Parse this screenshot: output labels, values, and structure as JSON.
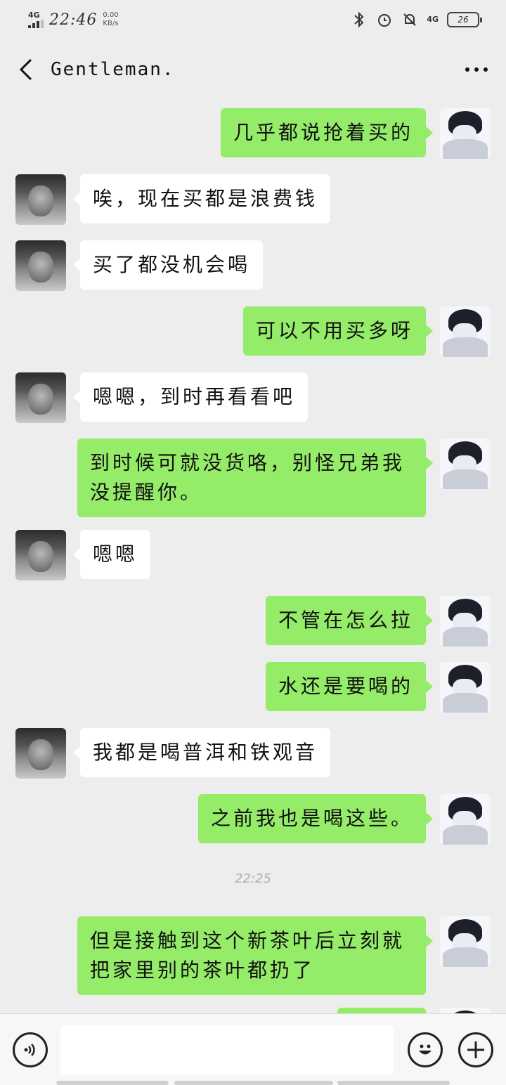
{
  "status_bar": {
    "network": "4G",
    "time": "22:46",
    "speed_value": "0.00",
    "speed_unit": "KB/s",
    "network_right": "4G",
    "battery": "26"
  },
  "header": {
    "title": "Gentleman.",
    "back_icon": "chevron-left-icon",
    "more_icon": "more-dots-icon"
  },
  "messages": [
    {
      "side": "out",
      "text": "几乎都说抢着买的"
    },
    {
      "side": "in",
      "text": "唉，现在买都是浪费钱"
    },
    {
      "side": "in",
      "text": "买了都没机会喝"
    },
    {
      "side": "out",
      "text": "可以不用买多呀"
    },
    {
      "side": "in",
      "text": "嗯嗯，到时再看看吧"
    },
    {
      "side": "out",
      "text": "到时候可就没货咯，别怪兄弟我没提醒你。"
    },
    {
      "side": "in",
      "text": "嗯嗯"
    },
    {
      "side": "out",
      "text": "不管在怎么拉"
    },
    {
      "side": "out",
      "text": "水还是要喝的"
    },
    {
      "side": "in",
      "text": "我都是喝普洱和铁观音"
    },
    {
      "side": "out",
      "text": "之前我也是喝这些。"
    },
    {
      "side": "out",
      "text": "但是接触到这个新茶叶后立刻就把家里别的茶叶都扔了"
    }
  ],
  "timestamp": "22:25",
  "input_bar": {
    "voice_icon": "voice-icon",
    "emoji_icon": "emoji-icon",
    "plus_icon": "plus-icon",
    "input_value": ""
  },
  "colors": {
    "background": "#ededed",
    "outgoing_bubble": "#95ec69",
    "incoming_bubble": "#ffffff"
  }
}
